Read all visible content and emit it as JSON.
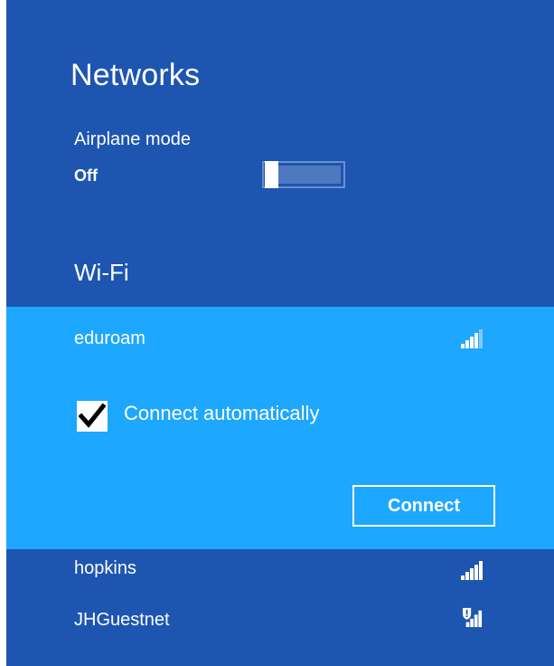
{
  "panel": {
    "title": "Networks",
    "background_color": "#1d55b1",
    "accent_color": "#1ea7ff"
  },
  "airplane_mode": {
    "label": "Airplane mode",
    "state": "Off",
    "enabled": false
  },
  "wifi": {
    "header": "Wi-Fi",
    "selected_network": {
      "name": "eduroam",
      "signal_icon": "wifi-signal-icon",
      "connect_automatically_label": "Connect automatically",
      "connect_automatically_checked": true,
      "connect_button_label": "Connect"
    },
    "networks": [
      {
        "name": "hopkins",
        "signal_icon": "wifi-signal-icon"
      },
      {
        "name": "JHGuestnet",
        "signal_icon": "wifi-signal-unsecured-icon"
      }
    ]
  }
}
